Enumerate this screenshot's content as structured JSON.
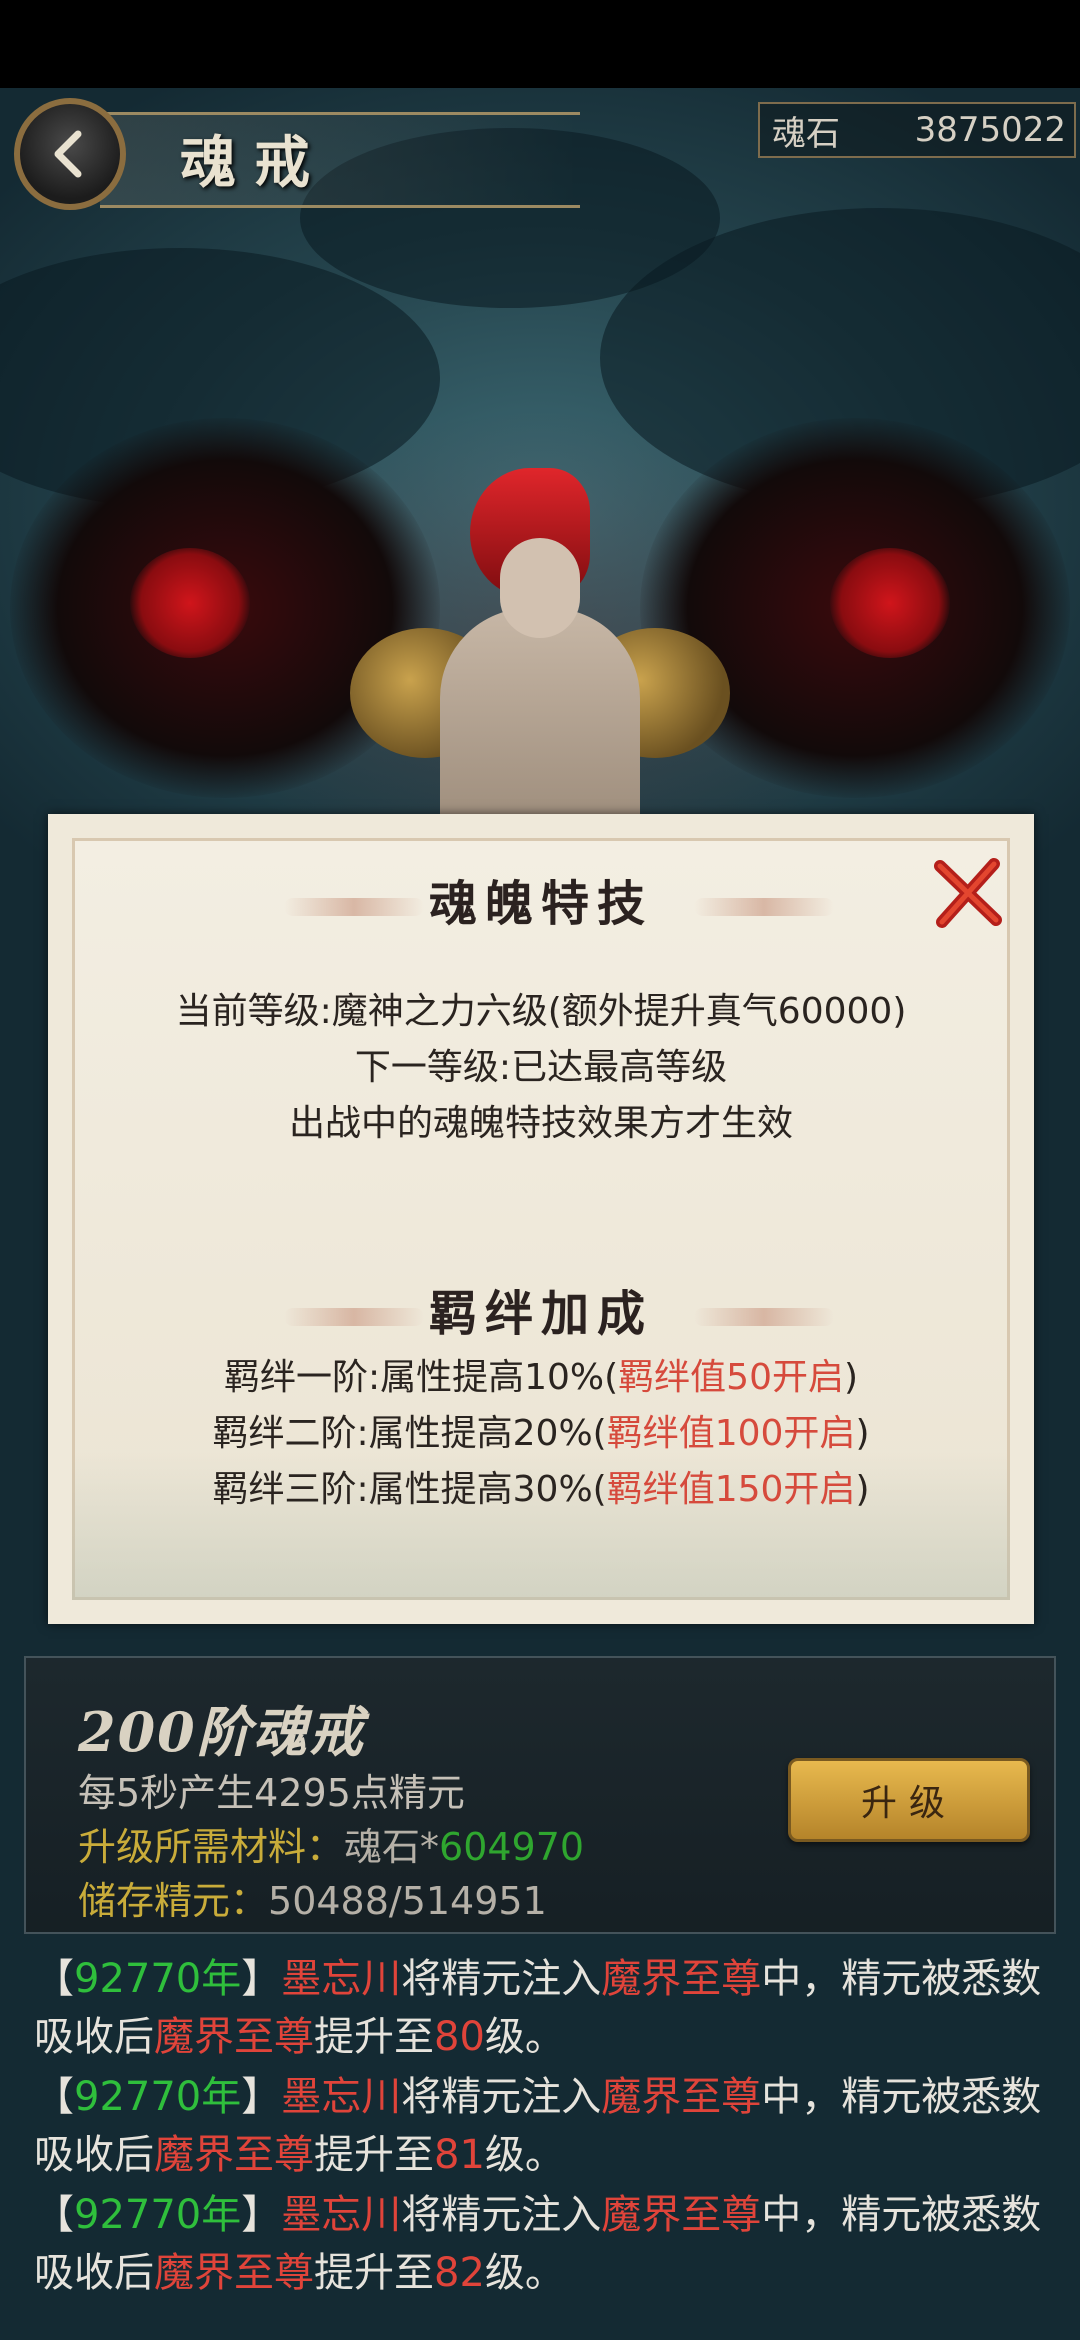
{
  "header": {
    "title": "魂戒",
    "currency_label": "魂石",
    "currency_value": "3875022"
  },
  "skill_popup": {
    "title": "魂魄特技",
    "current_level_label": "当前等级:",
    "current_level_value": "魔神之力六级(额外提升真气60000)",
    "next_level_label": "下一等级:",
    "next_level_value": "已达最高等级",
    "note": "出战中的魂魄特技效果方才生效",
    "bond_title": "羁绊加成",
    "bonds": [
      {
        "label": "羁绊一阶:属性提高10%(",
        "unlock": "羁绊值50开启",
        "close": ")"
      },
      {
        "label": "羁绊二阶:属性提高20%(",
        "unlock": "羁绊值100开启",
        "close": ")"
      },
      {
        "label": "羁绊三阶:属性提高30%(",
        "unlock": "羁绊值150开启",
        "close": ")"
      }
    ]
  },
  "panel": {
    "tier_title": "200阶魂戒",
    "production": "每5秒产生4295点精元",
    "material_label": "升级所需材料：",
    "material_item": "魂石*",
    "material_amount": "604970",
    "storage_label": "储存精元：",
    "storage_value": "50488/514951",
    "upgrade_label": "升级"
  },
  "log": [
    {
      "open": "【",
      "year": "92770年",
      "close": "】",
      "player": "墨忘川",
      "t1": "将精元注入",
      "target": "魔界至尊",
      "t2": "中，精元被悉数吸收后",
      "target2": "魔界至尊",
      "t3": "提升至",
      "level": "80",
      "t4": "级。"
    },
    {
      "open": "【",
      "year": "92770年",
      "close": "】",
      "player": "墨忘川",
      "t1": "将精元注入",
      "target": "魔界至尊",
      "t2": "中，精元被悉数吸收后",
      "target2": "魔界至尊",
      "t3": "提升至",
      "level": "81",
      "t4": "级。"
    },
    {
      "open": "【",
      "year": "92770年",
      "close": "】",
      "player": "墨忘川",
      "t1": "将精元注入",
      "target": "魔界至尊",
      "t2": "中，精元被悉数吸收后",
      "target2": "魔界至尊",
      "t3": "提升至",
      "level": "82",
      "t4": "级。"
    }
  ],
  "colors": {
    "highlight_red": "#d64a3c",
    "highlight_green": "#2fa62f",
    "highlight_yellow": "#c9ac3a",
    "button_gold": "#e8b94e"
  },
  "icons": {
    "back": "chevron-left-icon",
    "close": "close-icon"
  }
}
